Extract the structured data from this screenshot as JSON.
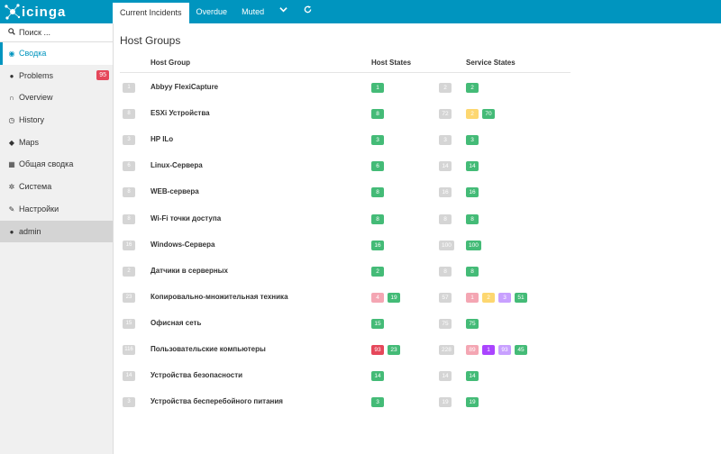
{
  "brand": {
    "name": "icinga"
  },
  "tabs": [
    {
      "label": "Current Incidents",
      "active": true
    },
    {
      "label": "Overdue"
    },
    {
      "label": "Muted"
    }
  ],
  "tab_icons": {
    "dropdown": "chevron-down-icon",
    "refresh": "refresh-icon"
  },
  "sidebar": {
    "search_placeholder": "Поиск ...",
    "items": [
      {
        "label": "Сводка",
        "icon": "dashboard-icon",
        "active": true
      },
      {
        "label": "Problems",
        "icon": "problems-icon",
        "badge": "95"
      },
      {
        "label": "Overview",
        "icon": "binoculars-icon"
      },
      {
        "label": "History",
        "icon": "history-icon"
      },
      {
        "label": "Maps",
        "icon": "map-marker-icon"
      },
      {
        "label": "Общая сводка",
        "icon": "grid-icon"
      },
      {
        "label": "Система",
        "icon": "cogs-icon"
      },
      {
        "label": "Настройки",
        "icon": "wrench-icon"
      },
      {
        "label": "admin",
        "icon": "user-icon"
      }
    ]
  },
  "main": {
    "title": "Host Groups",
    "columns": {
      "group": "Host Group",
      "host_states": "Host States",
      "service_states": "Service States"
    },
    "rows": [
      {
        "count": "1",
        "name": "Abbyy FlexiCapture",
        "host": [
          {
            "v": "1",
            "c": "g"
          }
        ],
        "svc_total": "2",
        "svc": [
          {
            "v": "2",
            "c": "g"
          }
        ]
      },
      {
        "count": "8",
        "name": "ESXi Устройства",
        "host": [
          {
            "v": "8",
            "c": "g"
          }
        ],
        "svc_total": "72",
        "svc": [
          {
            "v": "2",
            "c": "y"
          },
          {
            "v": "70",
            "c": "g"
          }
        ]
      },
      {
        "count": "3",
        "name": "HP ILo",
        "host": [
          {
            "v": "3",
            "c": "g"
          }
        ],
        "svc_total": "3",
        "svc": [
          {
            "v": "3",
            "c": "g"
          }
        ]
      },
      {
        "count": "6",
        "name": "Linux-Сервера",
        "host": [
          {
            "v": "6",
            "c": "g"
          }
        ],
        "svc_total": "14",
        "svc": [
          {
            "v": "14",
            "c": "g"
          }
        ]
      },
      {
        "count": "8",
        "name": "WEB-сервера",
        "host": [
          {
            "v": "8",
            "c": "g"
          }
        ],
        "svc_total": "16",
        "svc": [
          {
            "v": "16",
            "c": "g"
          }
        ]
      },
      {
        "count": "8",
        "name": "Wi-Fi точки доступа",
        "host": [
          {
            "v": "8",
            "c": "g"
          }
        ],
        "svc_total": "8",
        "svc": [
          {
            "v": "8",
            "c": "g"
          }
        ]
      },
      {
        "count": "16",
        "name": "Windows-Сервера",
        "host": [
          {
            "v": "16",
            "c": "g"
          }
        ],
        "svc_total": "100",
        "svc": [
          {
            "v": "100",
            "c": "g"
          }
        ]
      },
      {
        "count": "2",
        "name": "Датчики в серверных",
        "host": [
          {
            "v": "2",
            "c": "g"
          }
        ],
        "svc_total": "8",
        "svc": [
          {
            "v": "8",
            "c": "g"
          }
        ]
      },
      {
        "count": "23",
        "name": "Копировально-множительная техника",
        "host": [
          {
            "v": "4",
            "c": "p"
          },
          {
            "v": "19",
            "c": "g"
          }
        ],
        "svc_total": "57",
        "svc": [
          {
            "v": "1",
            "c": "p"
          },
          {
            "v": "2",
            "c": "y"
          },
          {
            "v": "3",
            "c": "lv"
          },
          {
            "v": "51",
            "c": "g"
          }
        ]
      },
      {
        "count": "15",
        "name": "Офисная сеть",
        "host": [
          {
            "v": "15",
            "c": "g"
          }
        ],
        "svc_total": "75",
        "svc": [
          {
            "v": "75",
            "c": "g"
          }
        ]
      },
      {
        "count": "116",
        "name": "Пользовательские компьютеры",
        "host": [
          {
            "v": "93",
            "c": "r"
          },
          {
            "v": "23",
            "c": "g"
          }
        ],
        "svc_total": "228",
        "svc": [
          {
            "v": "89",
            "c": "p"
          },
          {
            "v": "1",
            "c": "v"
          },
          {
            "v": "93",
            "c": "lv"
          },
          {
            "v": "45",
            "c": "g"
          }
        ]
      },
      {
        "count": "14",
        "name": "Устройства безопасности",
        "host": [
          {
            "v": "14",
            "c": "g"
          }
        ],
        "svc_total": "14",
        "svc": [
          {
            "v": "14",
            "c": "g"
          }
        ]
      },
      {
        "count": "3",
        "name": "Устройства бесперебойного питания",
        "host": [
          {
            "v": "3",
            "c": "g"
          }
        ],
        "svc_total": "19",
        "svc": [
          {
            "v": "19",
            "c": "g"
          }
        ]
      }
    ]
  },
  "colors": {
    "accent": "#0095bf",
    "ok": "#44bb77",
    "warning": "#fdd770",
    "critical_handled": "#f4a6b3",
    "critical": "#e5475a",
    "unknown": "#aa44ff",
    "unknown_handled": "#c8a0ff",
    "total": "#d5d5d5"
  }
}
